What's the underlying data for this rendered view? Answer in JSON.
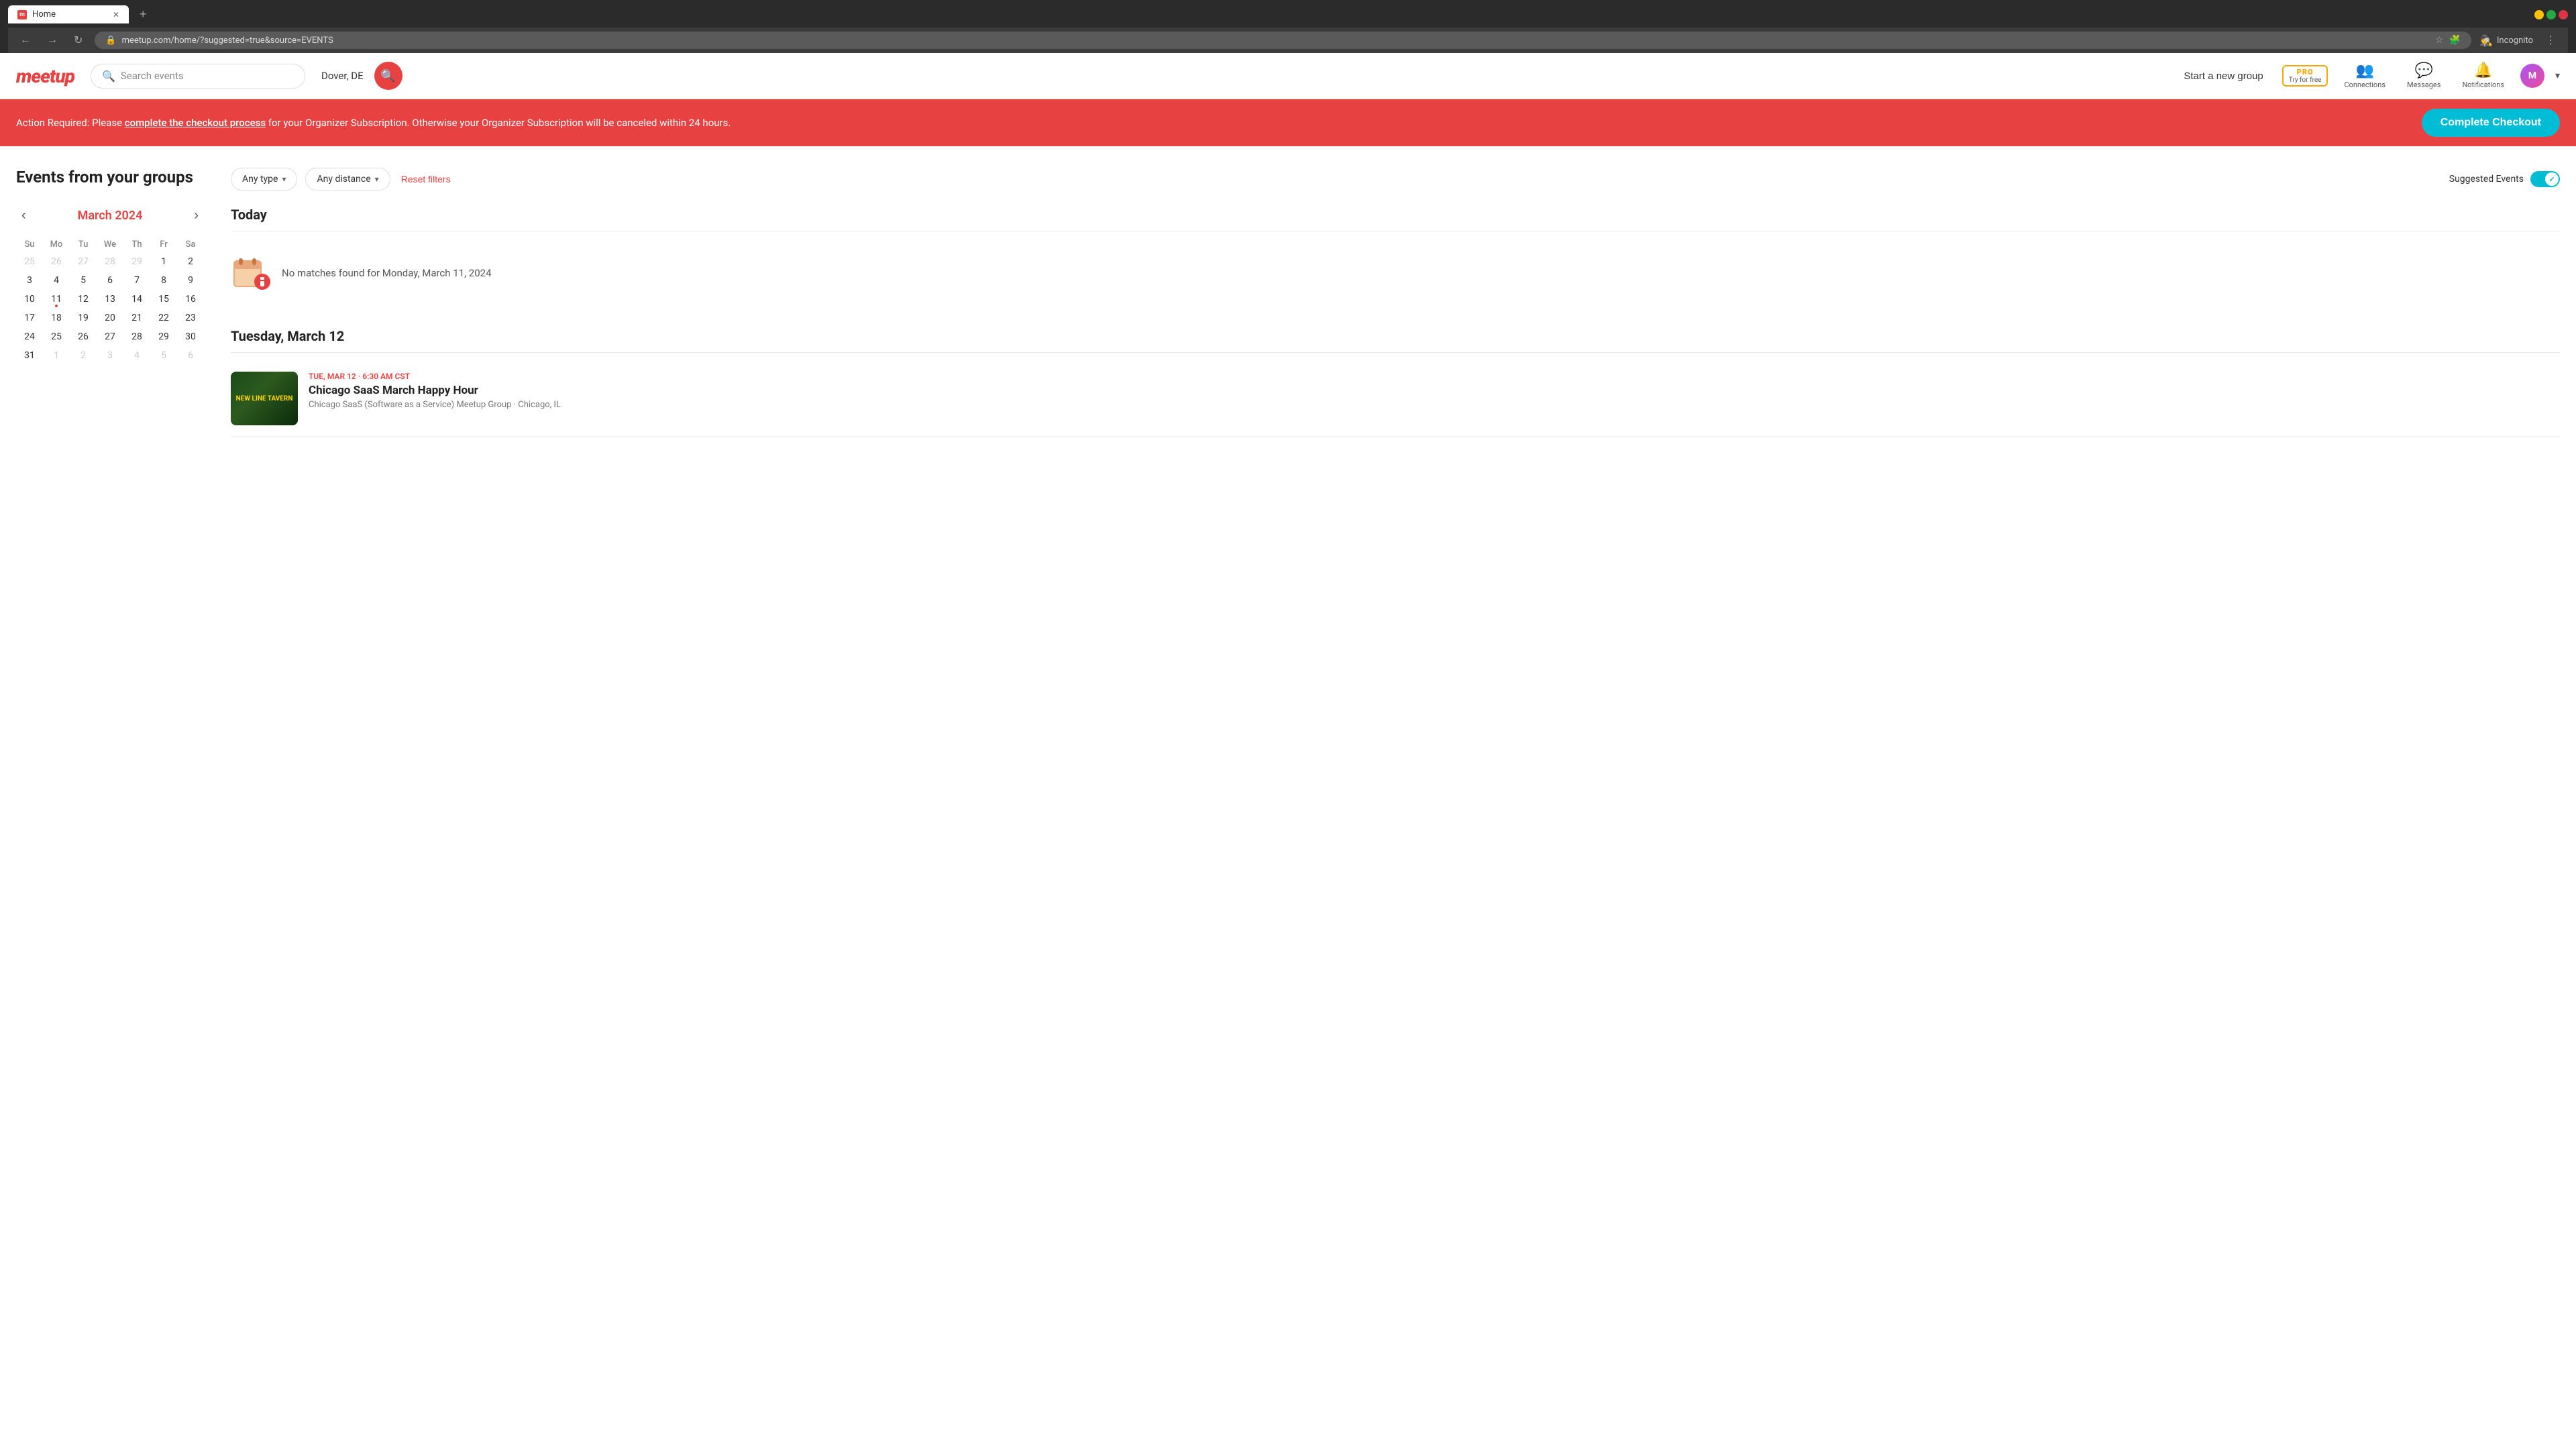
{
  "browser": {
    "tab_title": "Home",
    "url": "meetup.com/home/?suggested=true&source=EVENTS",
    "incognito_label": "Incognito"
  },
  "navbar": {
    "logo": "meetup",
    "search_placeholder": "Search events",
    "location": "Dover, DE",
    "start_group_label": "Start a new group",
    "pro_label": "PRO",
    "pro_sublabel": "Try for free",
    "connections_label": "Connections",
    "messages_label": "Messages",
    "notifications_label": "Notifications"
  },
  "banner": {
    "text_prefix": "Action Required: Please ",
    "link_text": "complete the checkout process",
    "text_suffix": " for your Organizer Subscription. Otherwise your Organizer Subscription will be canceled within 24 hours.",
    "cta_label": "Complete Checkout"
  },
  "page": {
    "title": "Events from your groups"
  },
  "calendar": {
    "month_label": "March 2024",
    "days_of_week": [
      "Su",
      "Mo",
      "Tu",
      "We",
      "Th",
      "Fr",
      "Sa"
    ],
    "weeks": [
      [
        {
          "day": 25,
          "other": true
        },
        {
          "day": 26,
          "other": true
        },
        {
          "day": 27,
          "other": true
        },
        {
          "day": 28,
          "other": true
        },
        {
          "day": 29,
          "other": true
        },
        {
          "day": 1,
          "other": false
        },
        {
          "day": 2,
          "other": false
        }
      ],
      [
        {
          "day": 3,
          "other": false
        },
        {
          "day": 4,
          "other": false
        },
        {
          "day": 5,
          "other": false
        },
        {
          "day": 6,
          "other": false
        },
        {
          "day": 7,
          "other": false
        },
        {
          "day": 8,
          "other": false
        },
        {
          "day": 9,
          "other": false
        }
      ],
      [
        {
          "day": 10,
          "other": false
        },
        {
          "day": 11,
          "other": false,
          "today": true
        },
        {
          "day": 12,
          "other": false
        },
        {
          "day": 13,
          "other": false
        },
        {
          "day": 14,
          "other": false
        },
        {
          "day": 15,
          "other": false
        },
        {
          "day": 16,
          "other": false
        }
      ],
      [
        {
          "day": 17,
          "other": false
        },
        {
          "day": 18,
          "other": false
        },
        {
          "day": 19,
          "other": false
        },
        {
          "day": 20,
          "other": false
        },
        {
          "day": 21,
          "other": false
        },
        {
          "day": 22,
          "other": false
        },
        {
          "day": 23,
          "other": false
        }
      ],
      [
        {
          "day": 24,
          "other": false
        },
        {
          "day": 25,
          "other": false
        },
        {
          "day": 26,
          "other": false
        },
        {
          "day": 27,
          "other": false
        },
        {
          "day": 28,
          "other": false
        },
        {
          "day": 29,
          "other": false
        },
        {
          "day": 30,
          "other": false
        }
      ],
      [
        {
          "day": 31,
          "other": false
        },
        {
          "day": 1,
          "other": true
        },
        {
          "day": 2,
          "other": true
        },
        {
          "day": 3,
          "other": true
        },
        {
          "day": 4,
          "other": true
        },
        {
          "day": 5,
          "other": true
        },
        {
          "day": 6,
          "other": true
        }
      ]
    ]
  },
  "filters": {
    "type_label": "Any type",
    "distance_label": "Any distance",
    "reset_label": "Reset filters",
    "suggested_label": "Suggested Events"
  },
  "today_section": {
    "label": "Today",
    "no_matches_text": "No matches found for Monday, March 11, 2024"
  },
  "tuesday_section": {
    "label": "Tuesday, March 12",
    "events": [
      {
        "date_label": "TUE, MAR 12 · 6:30 AM CST",
        "title": "Chicago SaaS March Happy Hour",
        "group": "Chicago SaaS (Software as a Service) Meetup Group · Chicago, IL",
        "image_text": "NEW LINE TAVERN"
      }
    ]
  }
}
